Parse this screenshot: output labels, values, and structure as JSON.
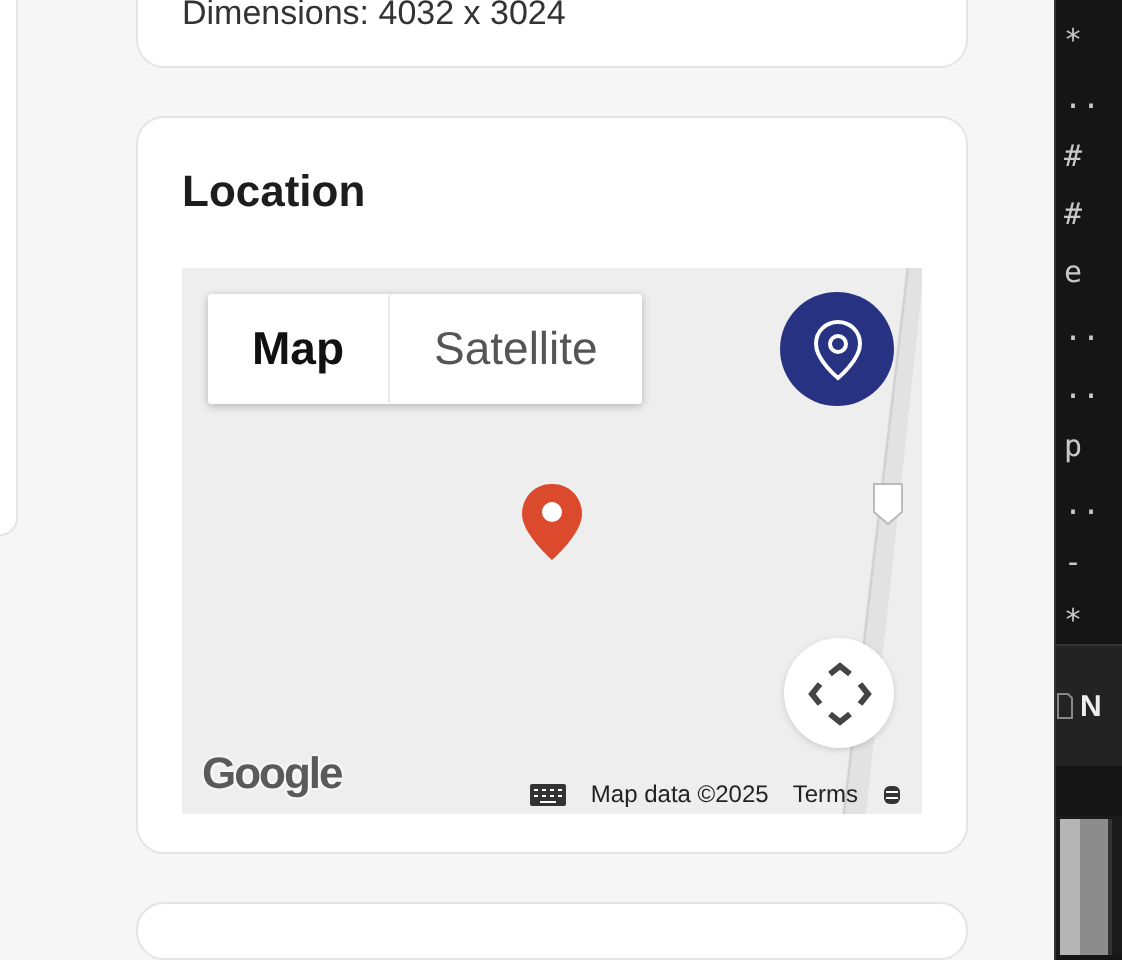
{
  "details_card": {
    "text": "Dimensions: 4032 x 3024"
  },
  "location_card": {
    "title": "Location",
    "map": {
      "kind": "picture",
      "map_types": [
        {
          "label": "Map",
          "selected": true
        },
        {
          "label": "Satellite",
          "selected": false
        }
      ],
      "logo": "Google",
      "attribution": "Map data ©2025",
      "terms": "Terms"
    }
  },
  "code_panel": {
    "lines": [
      "*",
      "..",
      "#",
      "#",
      "e",
      "..",
      "..",
      "p",
      "..",
      "-",
      "*"
    ],
    "tab": "N"
  }
}
